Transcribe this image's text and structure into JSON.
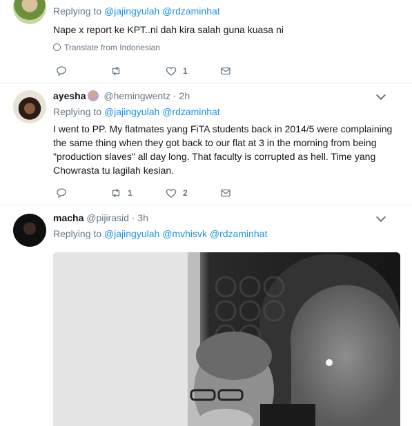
{
  "tweets": [
    {
      "replying_prefix": "Replying to",
      "mentions": [
        "@jajingyulah",
        "@rdzaminhat"
      ],
      "text": "Nape x report ke KPT..ni dah kira salah guna kuasa ni",
      "translate": "Translate from Indonesian",
      "retweets": "",
      "likes": "1"
    },
    {
      "name": "ayesha",
      "handle": "@hemingwentz",
      "time": "2h",
      "replying_prefix": "Replying to",
      "mentions": [
        "@jajingyulah",
        "@rdzaminhat"
      ],
      "text": "I went to PP. My flatmates yang FiTA students back in 2014/5 were complaining the same thing when they got back to our flat at 3 in the morning from being \"production slaves\" all day long. That faculty is corrupted as hell. Time yang Chowrasta tu lagilah kesian.",
      "retweets": "1",
      "likes": "2"
    },
    {
      "name": "macha",
      "handle": "@pijirasid",
      "time": "3h",
      "replying_prefix": "Replying to",
      "mentions": [
        "@jajingyulah",
        "@mvhisvk",
        "@rdzaminhat"
      ]
    }
  ],
  "separator": "·",
  "colors": {
    "link": "#1b95e0",
    "muted": "#657786",
    "border": "#e6ecf0"
  }
}
